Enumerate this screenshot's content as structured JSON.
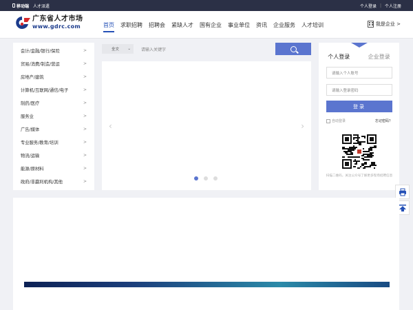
{
  "topbar": {
    "mobile_label": "移动端",
    "talent_label": "人才派遣",
    "login_link": "个人登录",
    "register_link": "个人注册"
  },
  "logo": {
    "cn": "广东省人才市场",
    "en": "www.gdrc.com"
  },
  "nav": [
    "首页",
    "求职招聘",
    "招聘会",
    "紧缺人才",
    "国有企业",
    "事业单位",
    "资讯",
    "企业服务",
    "人才培训"
  ],
  "nav_active_index": 0,
  "enterprise_link": "我是企业 >",
  "categories": [
    "会计/金融/银行/保险",
    "贸易/消费/制造/营运",
    "房地产/建筑",
    "计算机/互联网/通信/电子",
    "制药/医疗",
    "服务业",
    "广告/媒体",
    "专业服务/教育/培训",
    "物流/运输",
    "能源/原材料",
    "政府/非赢利机构/其他"
  ],
  "category_arrow": ">",
  "search": {
    "scope": "全文",
    "placeholder": "请输入关键字"
  },
  "carousel": {
    "prev": "‹",
    "next": "›",
    "slides": 3,
    "active": 0
  },
  "login": {
    "tab_personal": "个人登录",
    "tab_company": "企业登录",
    "account_placeholder": "请输入个人账号",
    "password_placeholder": "请输入登录密码",
    "submit": "登录",
    "auto_login": "自动登录",
    "forgot": "忘记密码？",
    "qr_hint": "扫描二维码，关注公众号了解更多现场招聘信息"
  },
  "colors": {
    "accent": "#5b75cf",
    "nav_active": "#2450b6",
    "topbar": "#2b3046",
    "background": "#f0f1f5"
  },
  "icons": {
    "search": "magnifier-icon",
    "enterprise": "building-icon",
    "side1": "printer-icon",
    "side2": "back-to-top-icon"
  }
}
